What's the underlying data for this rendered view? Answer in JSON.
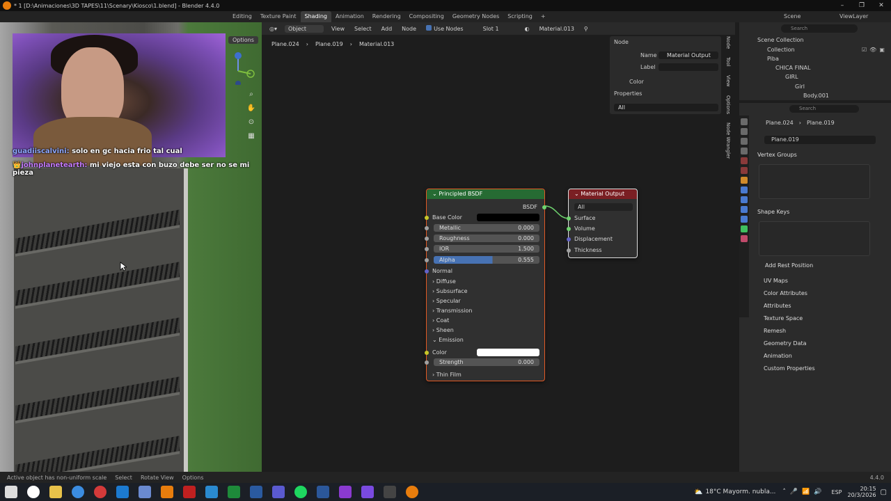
{
  "window": {
    "title": "* 1 [D:\\Animaciones\\3D TAPES\\11\\Scenary\\Kiosco\\1.blend] - Blender 4.4.0",
    "minimize": "–",
    "maximize": "❐",
    "close": "✕"
  },
  "workspaces": [
    "Editing",
    "Texture Paint",
    "Shading",
    "Animation",
    "Rendering",
    "Compositing",
    "Geometry Nodes",
    "Scripting",
    "+"
  ],
  "active_workspace": "Shading",
  "scene_selector": {
    "label": "Scene",
    "view_layer": "ViewLayer"
  },
  "viewport": {
    "options_label": "Options",
    "chat": [
      {
        "user": "guadiiscalvini:",
        "message": "solo en gc hacia frio tal cual"
      },
      {
        "user": "johnplanetearth:",
        "message": "mi viejo esta con buzo debe ser no se mi pieza",
        "badge": "👑"
      }
    ]
  },
  "node_header": {
    "object_mode": "Object",
    "menus": [
      "View",
      "Select",
      "Add",
      "Node"
    ],
    "use_nodes_label": "Use Nodes",
    "slot": "Slot 1",
    "material": "Material.013"
  },
  "breadcrumbs": [
    "Plane.024",
    "Plane.019",
    "Material.013"
  ],
  "node_panel": {
    "title": "Node",
    "name_label": "Name",
    "name_value": "Material Output",
    "label_label": "Label",
    "color_label": "Color",
    "properties_label": "Properties",
    "properties_value": "All"
  },
  "side_tabs": [
    "Node",
    "Tool",
    "View",
    "Options",
    "Node Wrangler"
  ],
  "principled": {
    "title": "Principled BSDF",
    "output": "BSDF",
    "base_color_label": "Base Color",
    "metallic": {
      "label": "Metallic",
      "value": "0.000"
    },
    "roughness": {
      "label": "Roughness",
      "value": "0.000"
    },
    "ior": {
      "label": "IOR",
      "value": "1.500"
    },
    "alpha": {
      "label": "Alpha",
      "value": "0.555",
      "fraction": 0.555
    },
    "normal_label": "Normal",
    "panels": [
      "Diffuse",
      "Subsurface",
      "Specular",
      "Transmission",
      "Coat",
      "Sheen"
    ],
    "emission_label": "Emission",
    "emission_color_label": "Color",
    "strength": {
      "label": "Strength",
      "value": "0.000"
    },
    "thin_film_label": "Thin Film",
    "base_color_hex": "#000000",
    "emission_color_hex": "#ffffff"
  },
  "material_output": {
    "title": "Material Output",
    "target": "All",
    "inputs": [
      "Surface",
      "Volume",
      "Displacement",
      "Thickness"
    ]
  },
  "outliner": {
    "search_placeholder": "Search",
    "items": [
      "Scene Collection",
      "Collection",
      "Piba",
      "CHICA FINAL",
      "GIRL",
      "Girl",
      "Body.001"
    ]
  },
  "properties": {
    "search_placeholder": "Search",
    "path": [
      "Plane.024",
      "Plane.019"
    ],
    "mesh_name": "Plane.019",
    "sections": {
      "vertex_groups": "Vertex Groups",
      "shape_keys": "Shape Keys",
      "add_rest_position": "Add Rest Position",
      "collapsed": [
        "UV Maps",
        "Color Attributes",
        "Attributes",
        "Texture Space",
        "Remesh",
        "Geometry Data",
        "Animation",
        "Custom Properties"
      ]
    }
  },
  "statusbar": {
    "items": [
      "Active object has non-uniform scale",
      "Select",
      "Rotate View",
      "Options"
    ],
    "version": "4.4.0"
  },
  "taskbar": {
    "weather": "18°C  Mayorm. nubla...",
    "language": "ESP",
    "time": "20:15",
    "date": "20/3/2026"
  },
  "colors": {
    "principled_header": "#266b33",
    "output_header": "#7a1f23",
    "alpha_fill": "#4772b3",
    "accent_orange": "#e87d0d"
  }
}
